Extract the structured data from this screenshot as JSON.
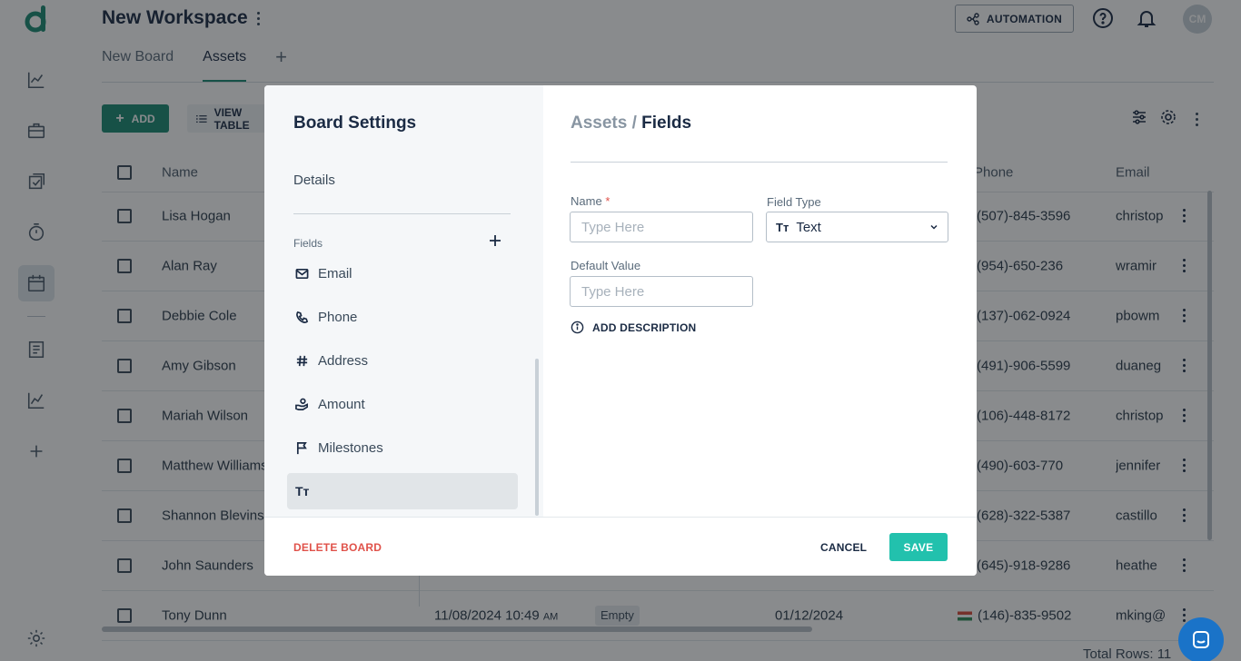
{
  "workspace": {
    "title": "New Workspace"
  },
  "header": {
    "automation_label": "AUTOMATION",
    "avatar_initials": "CM"
  },
  "tabs": [
    {
      "label": "New Board"
    },
    {
      "label": "Assets"
    }
  ],
  "toolbar": {
    "add_label": "ADD",
    "view_label": "VIEW TABLE"
  },
  "table": {
    "headers": {
      "name": "Name",
      "phone": "Phone",
      "email": "Email"
    },
    "rows": [
      {
        "name": "Lisa Hogan",
        "phone": "(507)-845-3596",
        "email": "christop"
      },
      {
        "name": "Alan Ray",
        "phone": "(954)-650-236",
        "email": "wramir"
      },
      {
        "name": "Debbie Cole",
        "phone": "(137)-062-0924",
        "email": "pbowm"
      },
      {
        "name": "Amy Gibson",
        "phone": "(491)-906-5599",
        "email": "duaneg"
      },
      {
        "name": "Mariah Wilson",
        "phone": "(106)-448-8172",
        "email": "christop"
      },
      {
        "name": "Matthew Williams",
        "phone": "(490)-603-770",
        "email": "jennifer"
      },
      {
        "name": "Shannon Blevins",
        "phone": "(628)-322-5387",
        "email": "castillo"
      },
      {
        "name": "John Saunders",
        "phone": "(645)-918-9286",
        "email": "heathe"
      },
      {
        "name": "Tony Dunn",
        "datetime": "11/08/2024 10:49",
        "ampm": "AM",
        "status": "Empty",
        "date": "01/12/2024",
        "phone": "(146)-835-9502",
        "email": "mking@"
      }
    ],
    "total_rows": "Total Rows: 11"
  },
  "modal": {
    "title": "Board Settings",
    "details_label": "Details",
    "fields_label": "Fields",
    "fields": [
      {
        "label": "Email",
        "icon": "mail-icon"
      },
      {
        "label": "Phone",
        "icon": "phone-icon"
      },
      {
        "label": "Address",
        "icon": "hash-icon"
      },
      {
        "label": "Amount",
        "icon": "money-hand-icon"
      },
      {
        "label": "Milestones",
        "icon": "flag-icon"
      },
      {
        "label": "",
        "icon": "text-type-icon"
      }
    ],
    "breadcrumb_parent": "Assets",
    "breadcrumb_sep": "/",
    "breadcrumb_current": "Fields",
    "name_label": "Name",
    "required_mark": "*",
    "name_placeholder": "Type Here",
    "field_type_label": "Field Type",
    "field_type_icon": "Tт",
    "field_type_value": "Text",
    "default_value_label": "Default Value",
    "default_value_placeholder": "Type Here",
    "add_description_label": "ADD DESCRIPTION",
    "delete_label": "DELETE BOARD",
    "cancel_label": "CANCEL",
    "save_label": "SAVE"
  },
  "colors": {
    "brand": "#1a8a73",
    "save": "#22c1ad",
    "danger": "#e0524a",
    "chat": "#1a73c8"
  }
}
